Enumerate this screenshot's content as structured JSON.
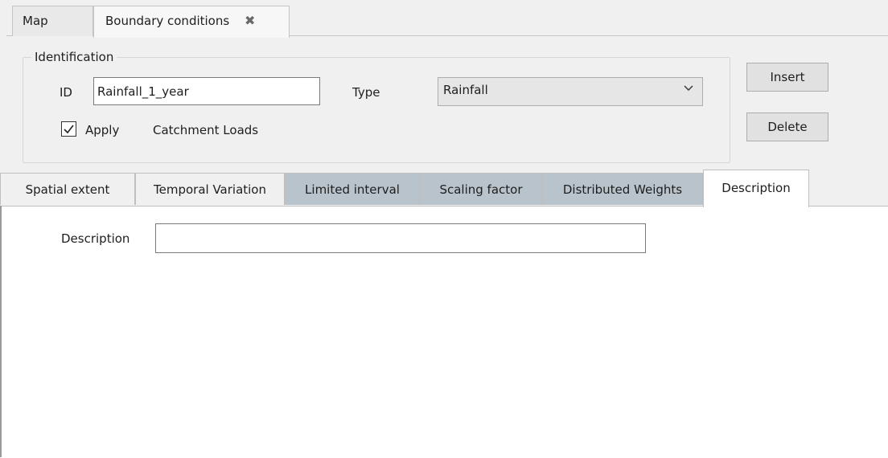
{
  "top_tabs": [
    {
      "label": "Map"
    },
    {
      "label": "Boundary conditions",
      "close": "✖"
    }
  ],
  "identification": {
    "legend": "Identification",
    "id_label": "ID",
    "id_value": "Rainfall_1_year",
    "type_label": "Type",
    "type_value": "Rainfall",
    "apply_label": "Apply",
    "apply_checked": true,
    "catchment_label": "Catchment Loads"
  },
  "buttons": {
    "insert": "Insert",
    "delete": "Delete"
  },
  "inner_tabs": [
    {
      "label": "Spatial extent",
      "style": "plain"
    },
    {
      "label": "Temporal Variation",
      "style": "plain"
    },
    {
      "label": "Limited interval",
      "style": "dark"
    },
    {
      "label": "Scaling factor",
      "style": "dark"
    },
    {
      "label": "Distributed Weights",
      "style": "dark"
    },
    {
      "label": "Description",
      "style": "active"
    }
  ],
  "description": {
    "label": "Description",
    "value": ""
  },
  "icons": {
    "close": "close-icon",
    "checkbox": "checkmark-icon",
    "dropdown": "chevron-down-icon"
  }
}
